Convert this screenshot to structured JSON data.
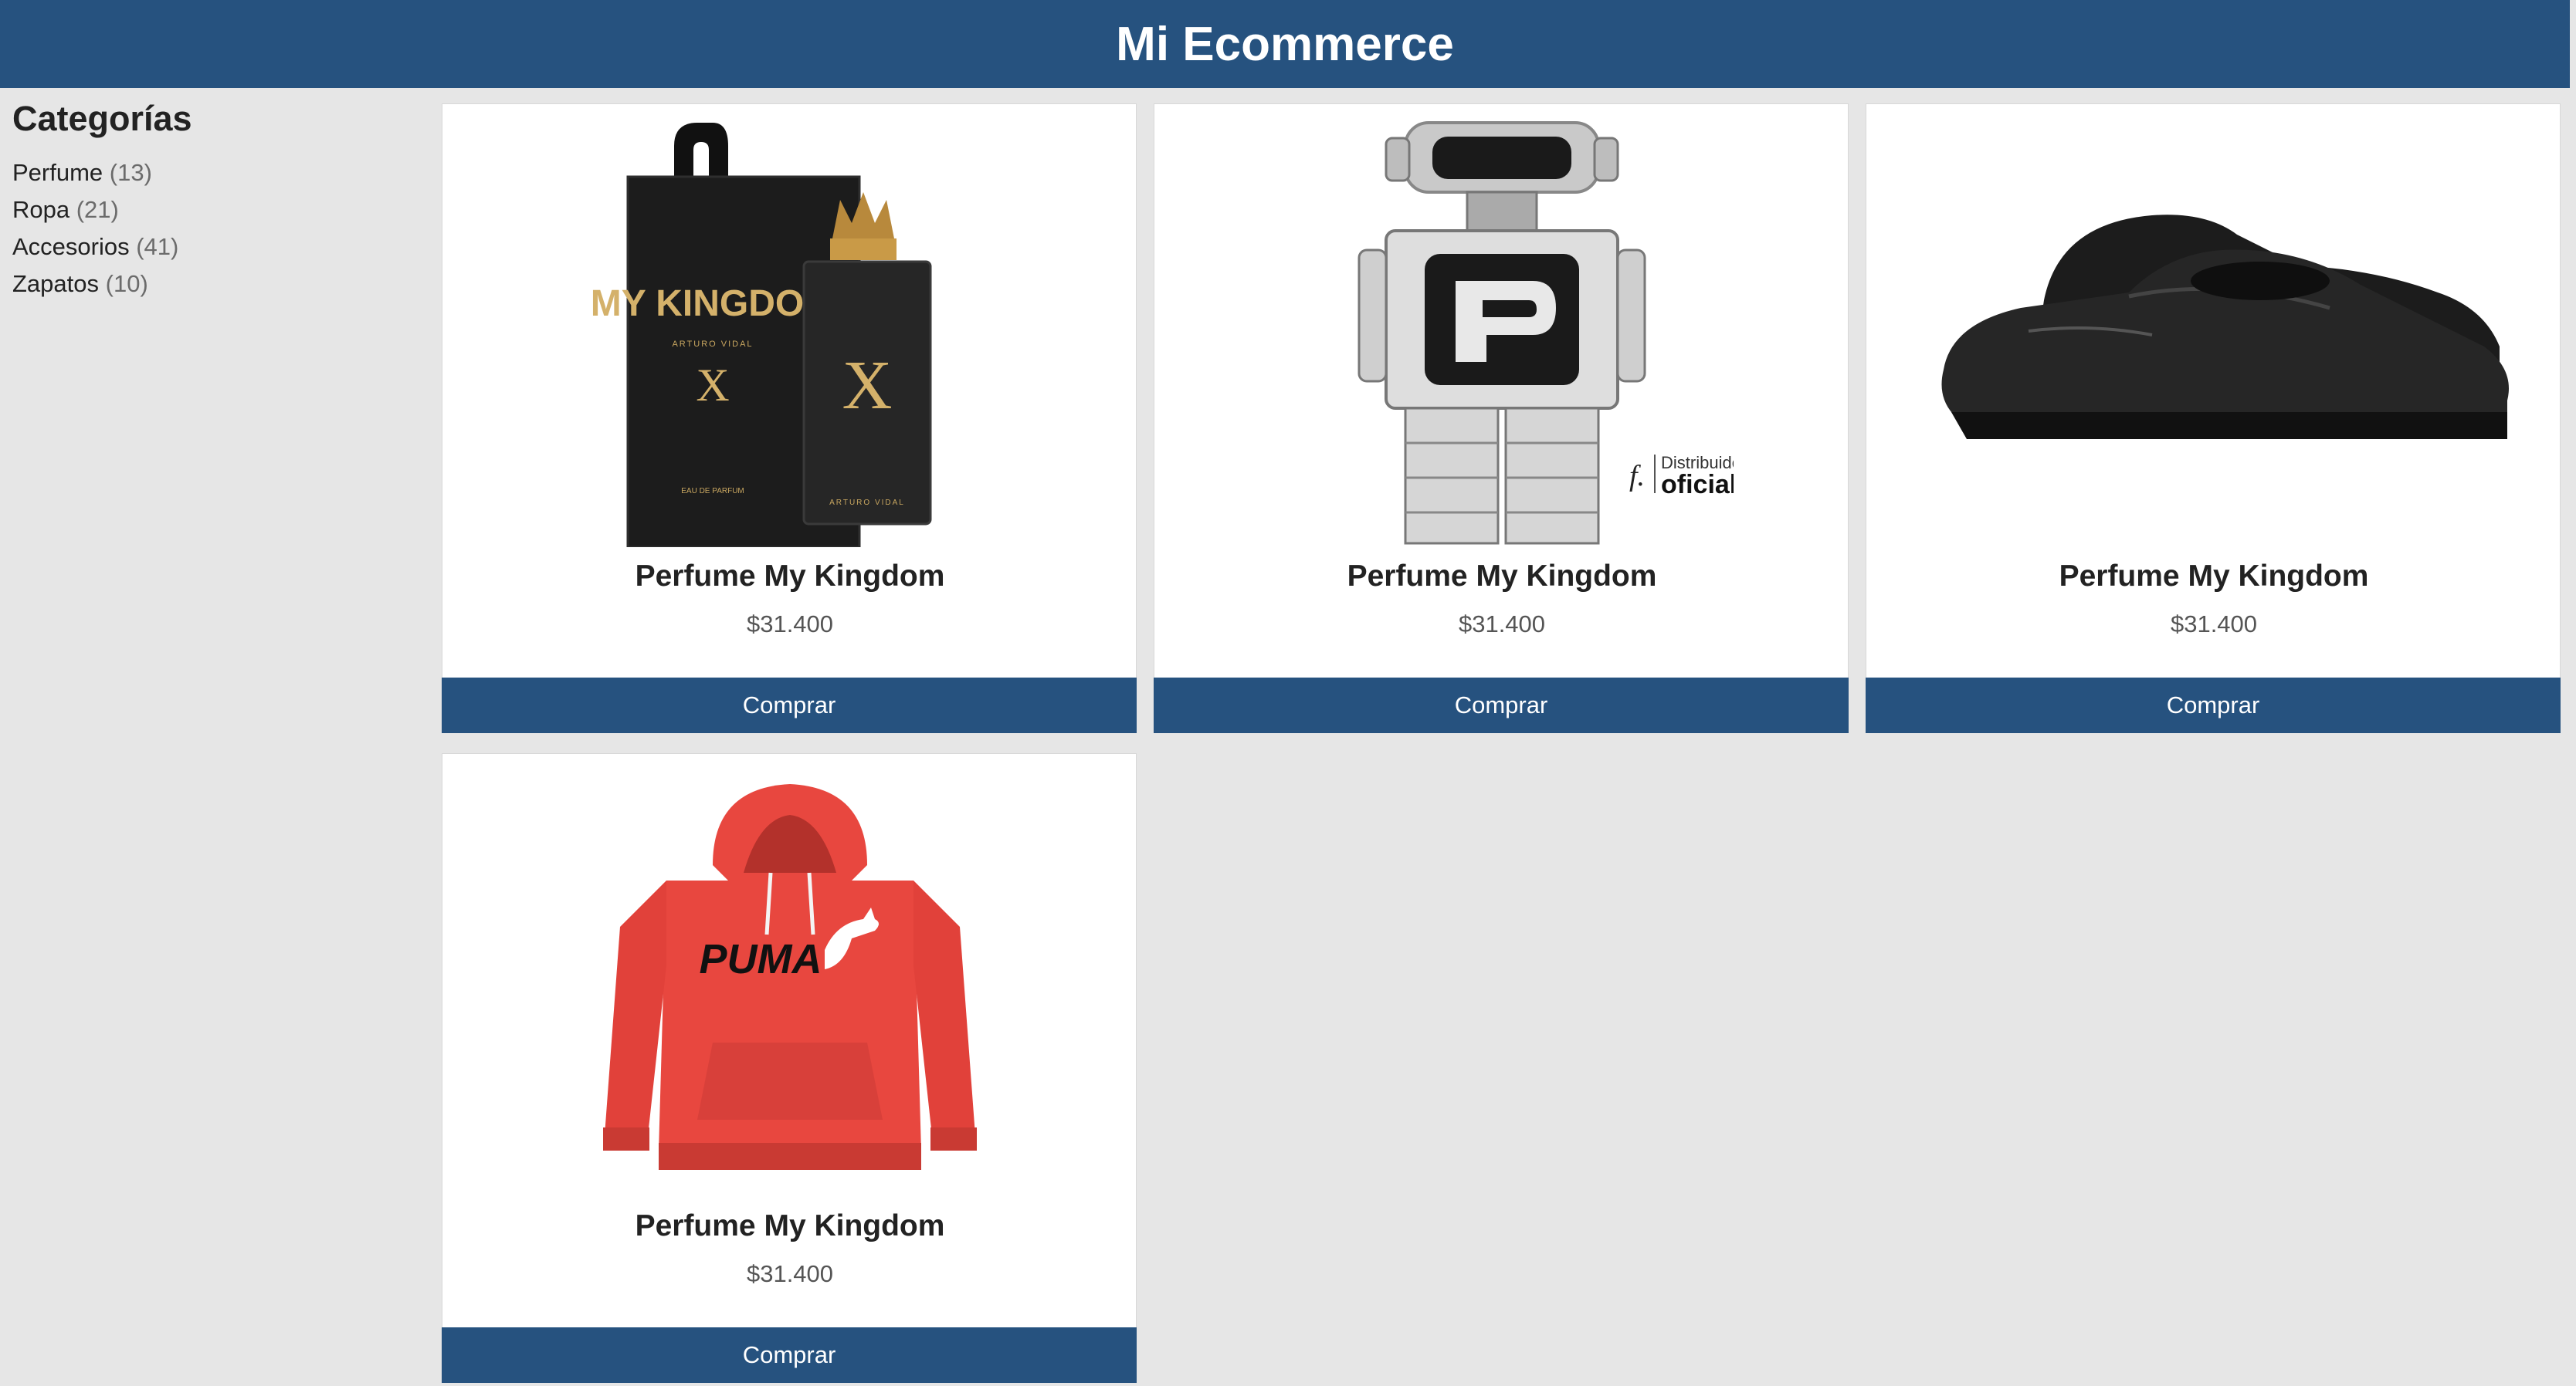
{
  "header": {
    "title": "Mi Ecommerce"
  },
  "sidebar": {
    "heading": "Categorías",
    "categories": [
      {
        "name": "Perfume",
        "count": "(13)"
      },
      {
        "name": "Ropa",
        "count": "(21)"
      },
      {
        "name": "Accesorios",
        "count": "(41)"
      },
      {
        "name": "Zapatos",
        "count": "(10)"
      }
    ]
  },
  "products": [
    {
      "title": "Perfume My Kingdom",
      "price": "$31.400",
      "button": "Comprar",
      "image": "perfume-box-image",
      "image_text": {
        "brand": "MY KINGDOM",
        "maker": "ARTURO VIDAL",
        "type": "EAU DE PARFUM"
      }
    },
    {
      "title": "Perfume My Kingdom",
      "price": "$31.400",
      "button": "Comprar",
      "image": "robot-perfume-image",
      "image_text": {
        "badge_top": "Distribuidor",
        "badge_bottom": "oficial",
        "badge_mark": "f."
      }
    },
    {
      "title": "Perfume My Kingdom",
      "price": "$31.400",
      "button": "Comprar",
      "image": "shoe-image"
    },
    {
      "title": "Perfume My Kingdom",
      "price": "$31.400",
      "button": "Comprar",
      "image": "hoodie-image",
      "image_text": {
        "brand": "PUMA"
      }
    }
  ],
  "colors": {
    "header": "#26527f",
    "button": "#26527f",
    "background": "#e6e6e6",
    "hoodie": "#e8473f"
  }
}
